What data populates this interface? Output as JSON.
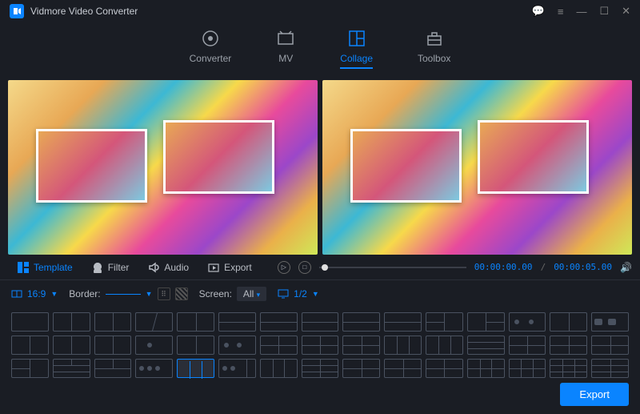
{
  "app": {
    "title": "Vidmore Video Converter"
  },
  "mainTabs": [
    {
      "label": "Converter"
    },
    {
      "label": "MV"
    },
    {
      "label": "Collage"
    },
    {
      "label": "Toolbox"
    }
  ],
  "subTabs": [
    {
      "label": "Template"
    },
    {
      "label": "Filter"
    },
    {
      "label": "Audio"
    },
    {
      "label": "Export"
    }
  ],
  "playback": {
    "current": "00:00:00.00",
    "total": "00:00:05.00"
  },
  "options": {
    "aspect": "16:9",
    "borderLabel": "Border:",
    "screenLabel": "Screen:",
    "screenValue": "All",
    "zoom": "1/2"
  },
  "footer": {
    "export": "Export"
  },
  "colors": {
    "accent": "#0a84ff",
    "bg": "#1a1d24"
  }
}
